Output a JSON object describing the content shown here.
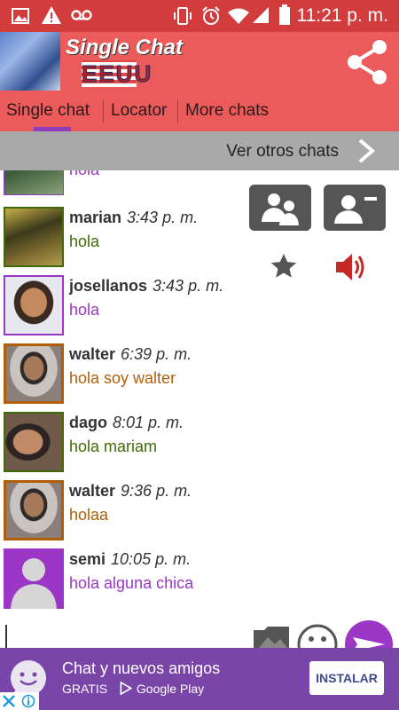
{
  "status_bar": {
    "time": "11:21 p. m.",
    "left_icons": [
      "image-icon",
      "warning-icon",
      "voicemail-icon"
    ],
    "right_icons": [
      "vibrate-icon",
      "alarm-icon",
      "wifi-icon",
      "signal-icon",
      "battery-icon"
    ]
  },
  "header": {
    "title": "Single Chat",
    "subtitle": "EEUU",
    "share_icon": "share-icon"
  },
  "tabs": [
    {
      "label": "Single chat",
      "active": true
    },
    {
      "label": "Locator",
      "active": false
    },
    {
      "label": "More chats",
      "active": false
    }
  ],
  "colors": {
    "status_bar": "#d33c3c",
    "header": "#ec5b5b",
    "tab_indicator": "#8e3dbd",
    "purple_text": "#9b36c6",
    "green_text": "#3f6a06",
    "orange_text": "#b25e08",
    "ad_bg": "#7a45a8"
  },
  "banner": {
    "label": "Ver otros chats"
  },
  "messages": [
    {
      "name": "",
      "time": "",
      "text": "hola",
      "color": "#9b36c6",
      "avatar": "avatar-photo"
    },
    {
      "name": "marian",
      "time": "3:43 p. m.",
      "text": "hola",
      "color": "#3f6a06",
      "avatar": "avatar-photo"
    },
    {
      "name": "josellanos",
      "time": "3:43 p. m.",
      "text": "hola",
      "color": "#9b36c6",
      "avatar": "avatar-photo"
    },
    {
      "name": "walter",
      "time": "6:39 p. m.",
      "text": "hola soy walter",
      "color": "#b25e08",
      "avatar": "avatar-photo"
    },
    {
      "name": "dago",
      "time": "8:01 p. m.",
      "text": "hola mariam",
      "color": "#3f6a06",
      "avatar": "avatar-photo"
    },
    {
      "name": "walter",
      "time": "9:36 p. m.",
      "text": "holaa",
      "color": "#b25e08",
      "avatar": "avatar-photo"
    },
    {
      "name": "semi",
      "time": "10:05 p. m.",
      "text": "hola alguna chica",
      "color": "#9b36c6",
      "avatar": "default-avatar-icon"
    }
  ],
  "tools": {
    "icons": [
      "group-icon",
      "remove-contact-icon",
      "star-icon",
      "volume-icon",
      "gallery-icon",
      "emoji-icon",
      "send-icon"
    ]
  },
  "ad": {
    "headline": "Chat y nuevos amigos",
    "sub": "GRATIS",
    "store": "Google Play",
    "install_label": "INSTALAR",
    "icons": [
      "adchoices-close-icon",
      "adchoices-info-icon",
      "app-logo-icon"
    ]
  }
}
